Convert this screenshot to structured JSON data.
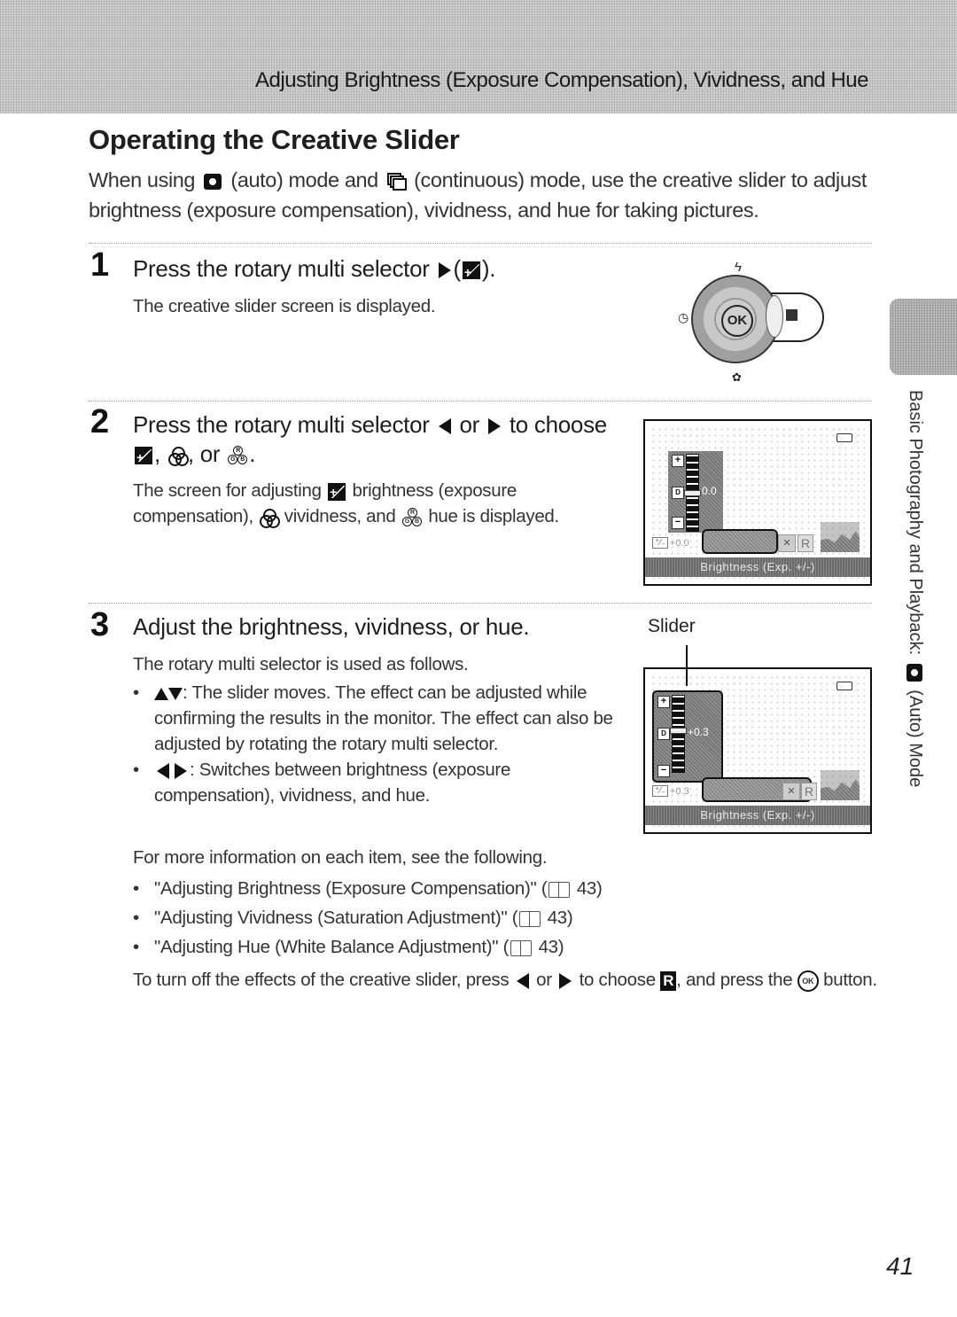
{
  "header": {
    "section_title": "Adjusting Brightness (Exposure Compensation), Vividness, and Hue"
  },
  "page_title": "Operating the Creative Slider",
  "intro": {
    "part1": "When using",
    "icon1": "auto-mode-camera-icon",
    "part2": "(auto) mode and",
    "icon2": "continuous-mode-icon",
    "part3": "(continuous) mode, use the creative slider to adjust brightness (exposure compensation), vividness, and hue for taking pictures."
  },
  "steps": [
    {
      "number": "1",
      "title_before": "Press the rotary multi selector",
      "title_after": ").",
      "open_paren": "(",
      "body": "The creative slider screen is displayed."
    },
    {
      "number": "2",
      "title_before": "Press the rotary multi selector",
      "title_or": "or",
      "title_to": "to",
      "title_choose": "choose",
      "title_comma": ",",
      "title_or2": ", or",
      "title_end": ".",
      "body_part1": "The screen for adjusting",
      "body_part2": "brightness (exposure compensation),",
      "body_part3": "vividness, and",
      "body_part4": "hue is displayed."
    },
    {
      "number": "3",
      "title": "Adjust the brightness, vividness, or hue.",
      "body_intro": "The rotary multi selector is used as follows.",
      "bullets": [
        {
          "keys": "up-down-arrows",
          "text": ": The slider moves. The effect can be adjusted while confirming the results in the monitor. The effect can also be adjusted by rotating the rotary multi selector."
        },
        {
          "keys": "left-right-arrows",
          "text": ": Switches between brightness (exposure compensation), vividness, and hue."
        }
      ]
    }
  ],
  "more_info": {
    "intro": "For more information on each item, see the following.",
    "refs": [
      {
        "text": "\"Adjusting Brightness (Exposure Compensation)\" (",
        "page": "43)"
      },
      {
        "text": "\"Adjusting Vividness (Saturation Adjustment)\" (",
        "page": "43)"
      },
      {
        "text": "\"Adjusting Hue (White Balance Adjustment)\" (",
        "page": "43)"
      }
    ]
  },
  "turn_off": {
    "part1": "To turn off the effects of the creative slider, press",
    "or": "or",
    "part2": "to choose",
    "r_icon": "R",
    "part3": ", and press the",
    "ok_icon": "OK",
    "part4": "button."
  },
  "dial": {
    "center_label": "OK"
  },
  "screens": [
    {
      "slider_value": "0.0",
      "ev_readout": "+0.0",
      "status": "Brightness (Exp. +/-)",
      "plus": "+",
      "minus": "−",
      "default_marker": "D",
      "slider_position": 0.5
    },
    {
      "slider_value": "+0.3",
      "ev_readout": "+0.3",
      "status": "Brightness (Exp. +/-)",
      "plus": "+",
      "minus": "−",
      "default_marker": "D",
      "slider_position": 0.55,
      "callout": "Slider"
    }
  ],
  "screen_tabs": {
    "x": "×",
    "r": "R"
  },
  "side_tab": {
    "text_before": "Basic Photography and Playback:",
    "text_after": "(Auto) Mode"
  },
  "page_number": "41"
}
